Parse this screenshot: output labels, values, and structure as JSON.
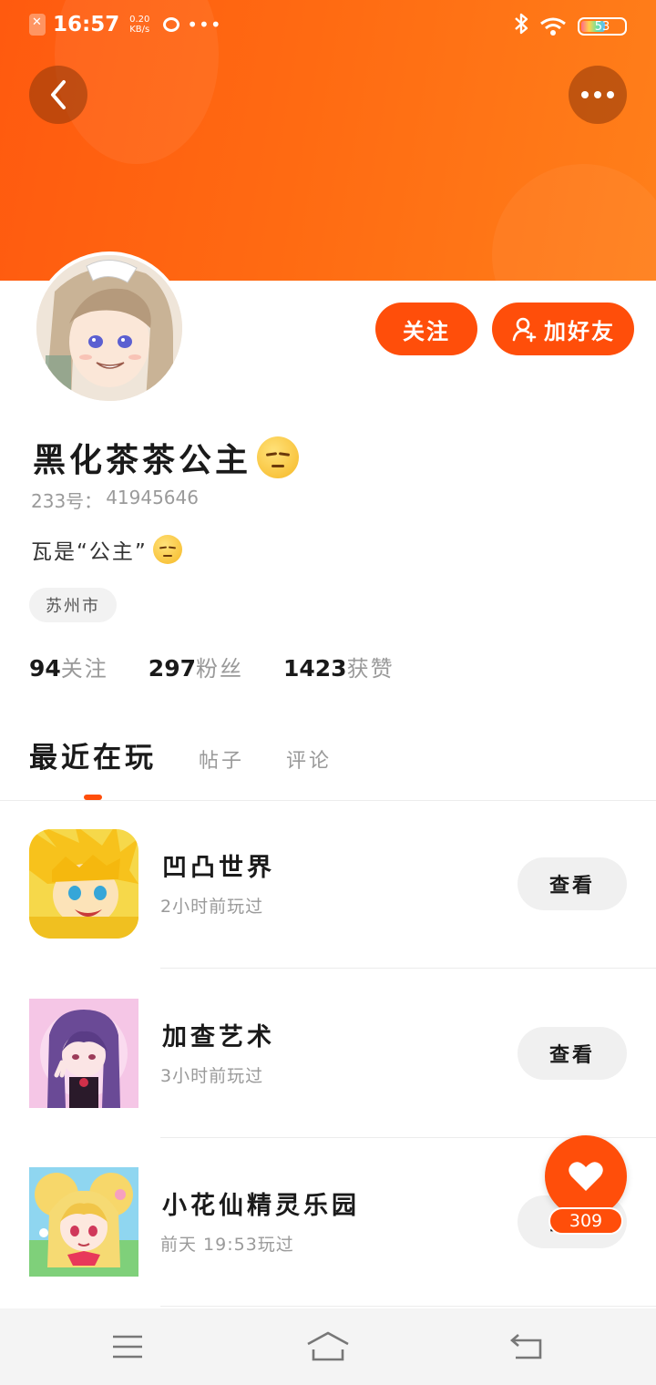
{
  "status_bar": {
    "time": "16:57",
    "net_speed_value": "0.20",
    "net_speed_unit": "KB/s",
    "battery_level": "53"
  },
  "colors": {
    "accent": "#ff4e0a",
    "banner": "#ff6a12"
  },
  "profile": {
    "follow_label": "关注",
    "add_friend_label": "加好友",
    "username": "黑化茶茶公主",
    "uid_label": "233号：",
    "uid_value": "41945646",
    "bio": "瓦是“公主”",
    "location": "苏州市",
    "stats": [
      {
        "num": "94",
        "label": "关注"
      },
      {
        "num": "297",
        "label": "粉丝"
      },
      {
        "num": "1423",
        "label": "获赞"
      }
    ]
  },
  "tabs": [
    {
      "label": "最近在玩"
    },
    {
      "label": "帖子"
    },
    {
      "label": "评论"
    }
  ],
  "games": [
    {
      "name": "凹凸世界",
      "time": "2小时前玩过",
      "button": "查看"
    },
    {
      "name": "加查艺术",
      "time": "3小时前玩过",
      "button": "查看"
    },
    {
      "name": "小花仙精灵乐园",
      "time": "前天 19:53玩过",
      "button": "查看"
    }
  ],
  "like": {
    "count": "309"
  },
  "icons": {
    "back": "chevron-left-icon",
    "more": "more-dots-icon",
    "like": "heart-icon",
    "nav_menu": "menu-icon",
    "nav_home": "home-icon",
    "nav_back": "return-icon"
  }
}
